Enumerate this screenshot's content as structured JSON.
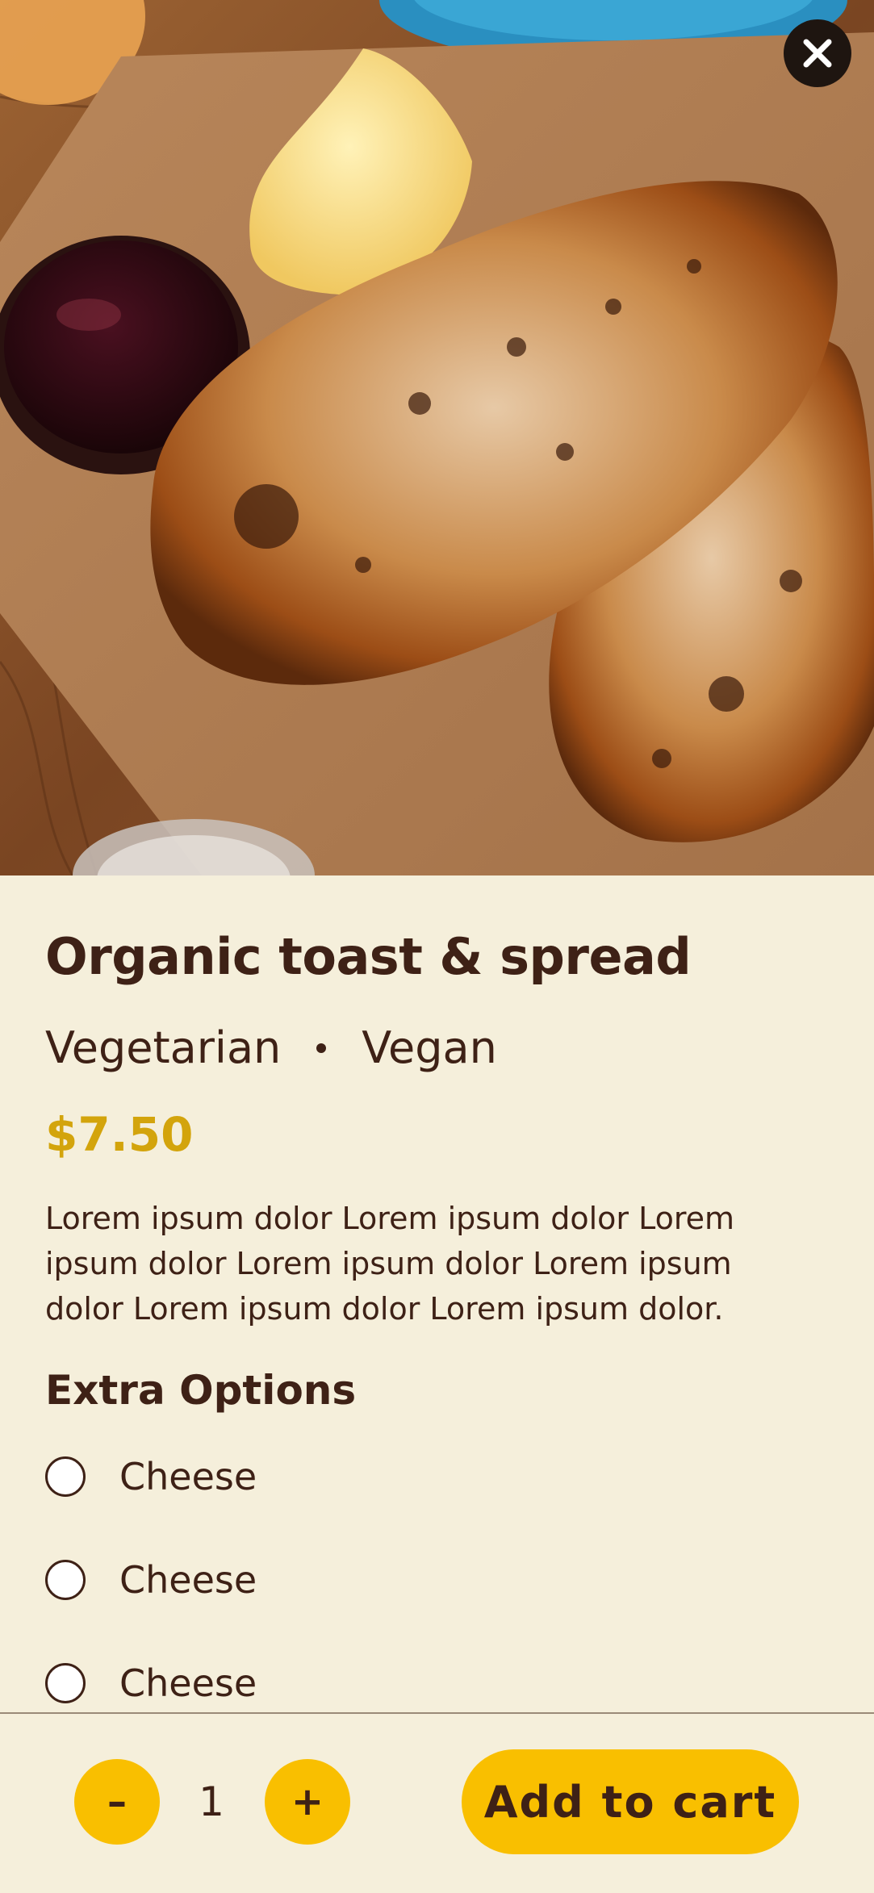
{
  "product": {
    "title": "Organic toast & spread",
    "tags": [
      "Vegetarian",
      "Vegan"
    ],
    "price": "$7.50",
    "description": "Lorem ipsum dolor Lorem ipsum dolor Lorem ipsum dolor Lorem ipsum dolor Lorem ipsum dolor Lorem ipsum dolor Lorem ipsum dolor."
  },
  "extras": {
    "title": "Extra Options",
    "options": [
      {
        "label": "Cheese",
        "selected": false
      },
      {
        "label": "Cheese",
        "selected": false
      },
      {
        "label": "Cheese",
        "selected": false
      }
    ]
  },
  "cart": {
    "decrement": "–",
    "quantity": "1",
    "increment": "+",
    "add_label": "Add to cart"
  },
  "colors": {
    "background": "#f5efdb",
    "accent": "#f9bf00",
    "price": "#d3a40c",
    "text": "#3e2116"
  },
  "icons": {
    "close": "close-icon"
  }
}
